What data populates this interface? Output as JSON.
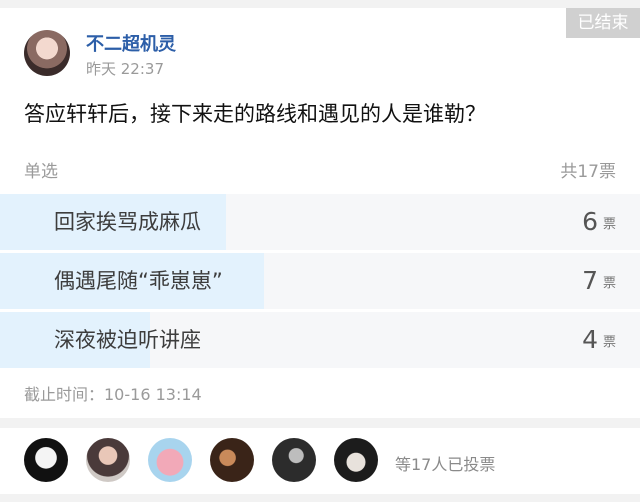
{
  "status_badge": "已结束",
  "author": {
    "name": "不二超机灵",
    "time": "昨天 22:37"
  },
  "question": "答应轩轩后，接下来走的路线和遇见的人是谁勒？",
  "poll": {
    "type_label": "单选",
    "total_label": "共17票",
    "unit": "票",
    "options": [
      {
        "label": "回家挨骂成麻瓜",
        "count": "6",
        "share": 0.353
      },
      {
        "label": "偶遇尾随“乖崽崽”",
        "count": "7",
        "share": 0.412
      },
      {
        "label": "深夜被迫听讲座",
        "count": "4",
        "share": 0.235
      }
    ]
  },
  "deadline": "截止时间：10-16 13:14",
  "voters_text": "等17人已投票",
  "colors": {
    "accent_name": "#2c5ea8",
    "bar_fill": "#e3f2fd",
    "bar_bg": "#f6f7f9"
  }
}
